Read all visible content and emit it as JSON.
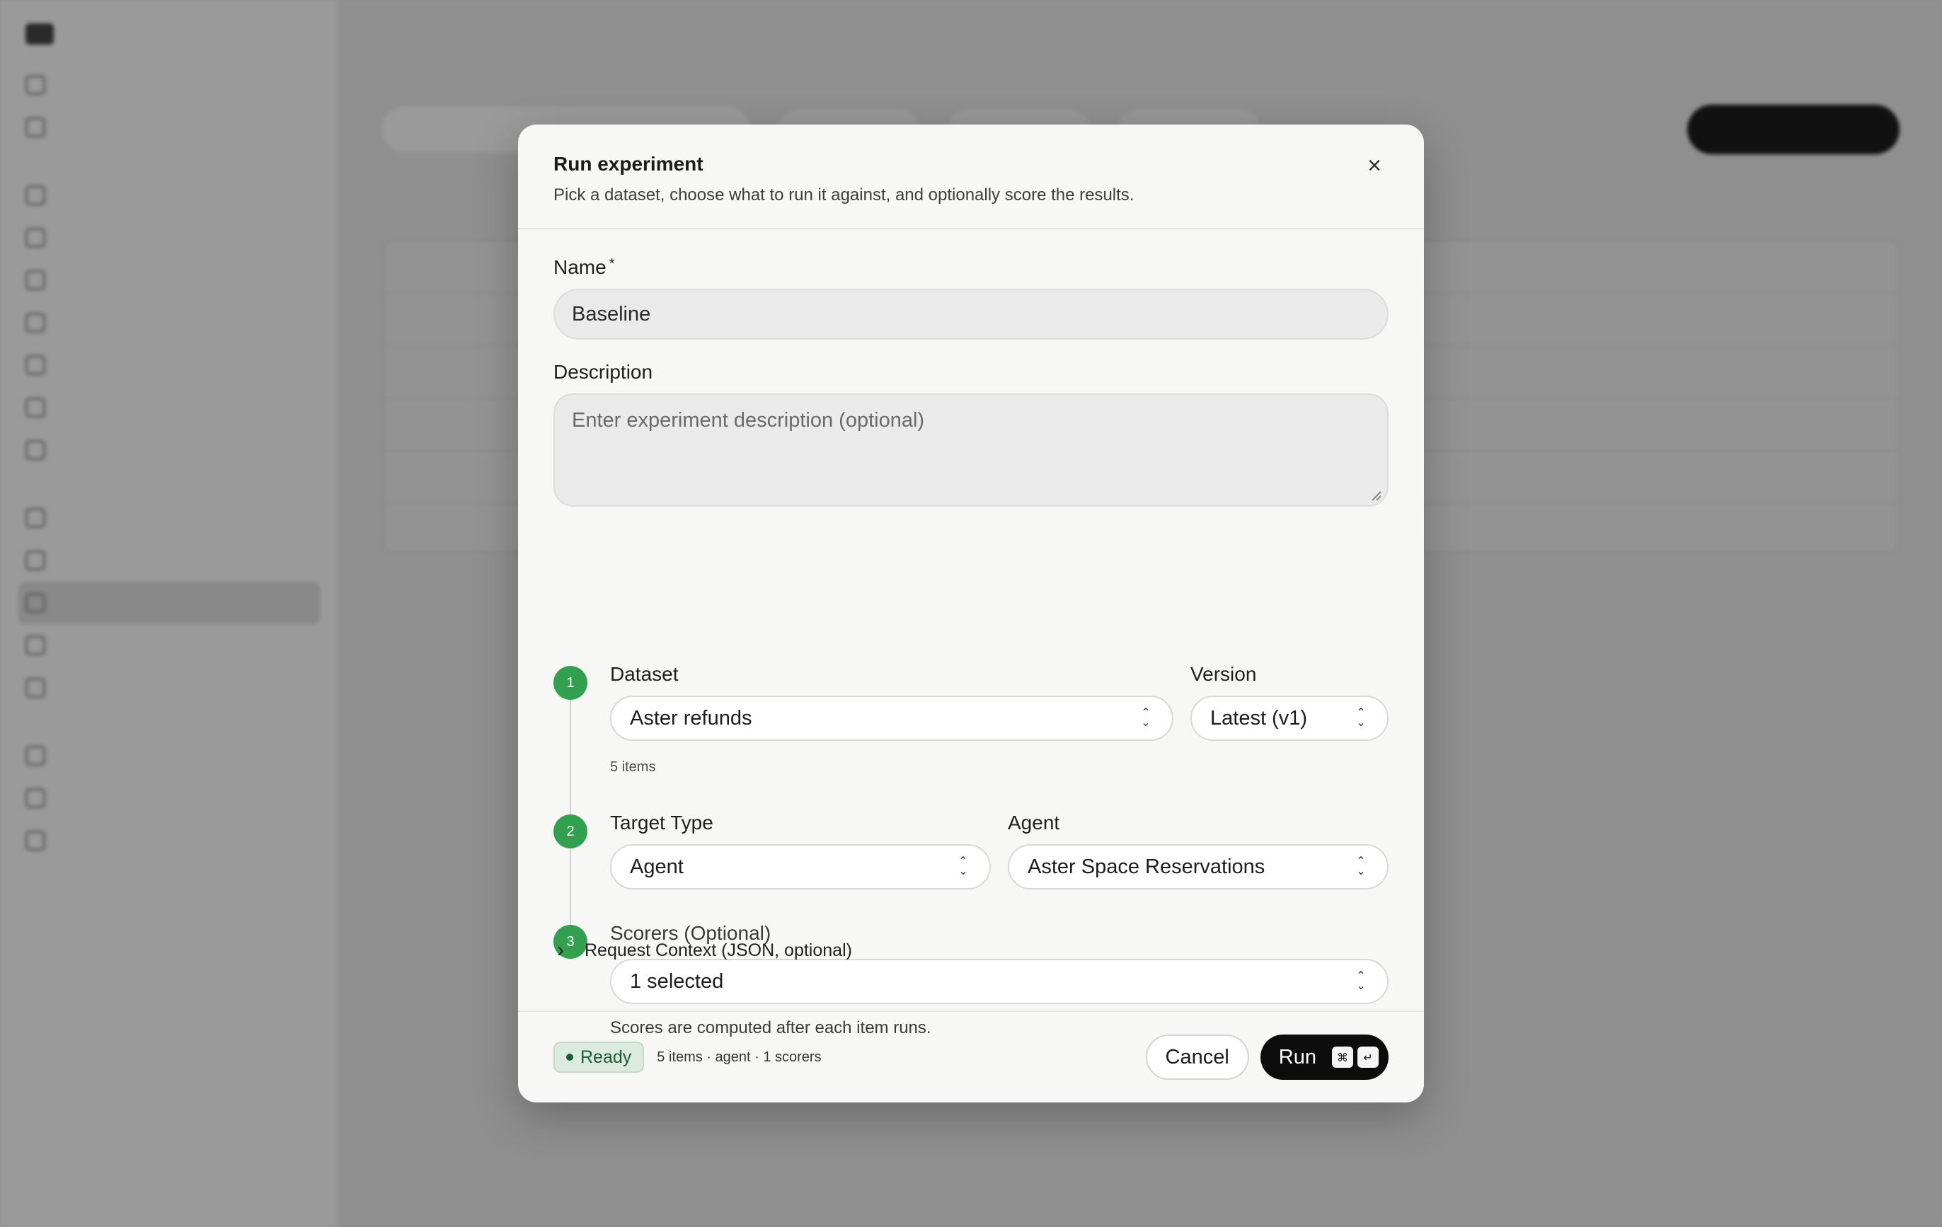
{
  "modal": {
    "title": "Run experiment",
    "subtitle": "Pick a dataset, choose what to run it against, and optionally score the results.",
    "name_label": "Name",
    "name_required": "*",
    "name_value": "Baseline",
    "description_label": "Description",
    "description_placeholder": "Enter experiment description (optional)",
    "steps": [
      {
        "number": "1",
        "dataset_label": "Dataset",
        "dataset_value": "Aster refunds",
        "version_label": "Version",
        "version_value": "Latest (v1)",
        "hint": "5 items"
      },
      {
        "number": "2",
        "target_type_label": "Target Type",
        "target_type_value": "Agent",
        "agent_label": "Agent",
        "agent_value": "Aster Space Reservations"
      },
      {
        "number": "3",
        "scorers_label": "Scorers (Optional)",
        "scorers_value": "1 selected",
        "hint": "Scores are computed after each item runs."
      }
    ],
    "request_context_label": "Request Context (JSON, optional)",
    "footer": {
      "status": "Ready",
      "meta": "5 items · agent · 1 scorers",
      "cancel_label": "Cancel",
      "run_label": "Run",
      "shortcut_keys": [
        "⌘",
        "↵"
      ]
    }
  },
  "colors": {
    "step_green": "#33a04f",
    "ready_bg": "#dcebe0",
    "ready_text": "#1e5a33",
    "run_button": "#0c0c0c"
  },
  "icons": {
    "close": "close-icon",
    "select_chevron": "chevron-up-down-icon",
    "expand": "chevron-right-icon"
  }
}
